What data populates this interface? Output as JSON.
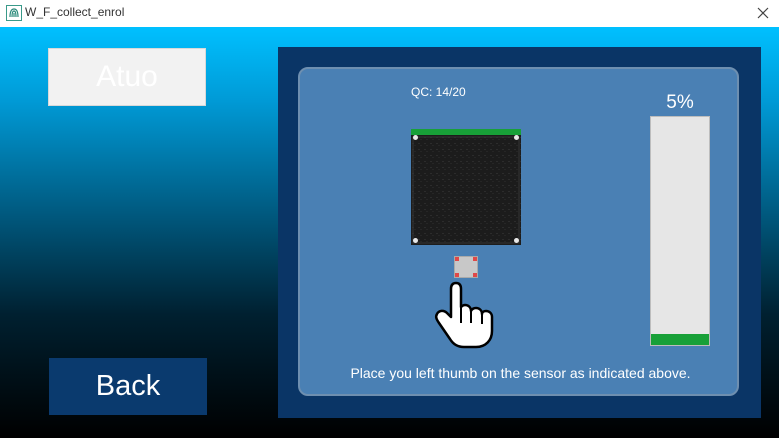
{
  "window": {
    "title": "W_F_collect_enrol"
  },
  "buttons": {
    "auto_label": "Atuo",
    "back_label": "Back"
  },
  "capture": {
    "qc_text": "QC: 14/20",
    "progress_label": "5%",
    "progress_percent": 5,
    "instruction": "Place you left thumb on the sensor as indicated above."
  },
  "icons": {
    "app": "fingerprint-app-icon",
    "close": "close-icon",
    "hand": "pointing-hand-icon"
  },
  "colors": {
    "progress_green": "#18a038",
    "back_button": "#0a3a6e",
    "panel_outer": "#0a3566",
    "panel_inner": "#4a80b4"
  }
}
